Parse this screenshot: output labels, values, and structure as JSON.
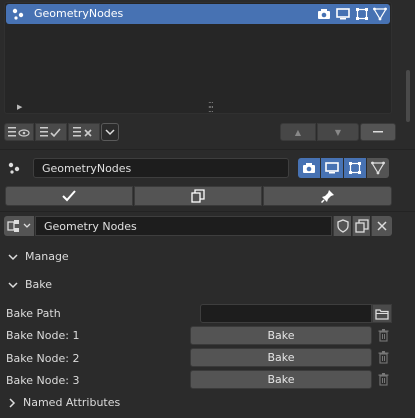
{
  "modifier_list": {
    "items": [
      {
        "label": "GeometryNodes",
        "selected": true
      }
    ]
  },
  "list_toolbar": {
    "icons": [
      "eye-list-icon",
      "checklist-icon",
      "x-list-icon",
      "chevron-down-icon",
      "triangle-up-icon",
      "triangle-down-icon",
      "minus-icon"
    ]
  },
  "modifier": {
    "name": "GeometryNodes",
    "actions": [
      "apply-check-icon",
      "duplicate-icon",
      "pin-icon"
    ]
  },
  "node_group": {
    "name": "Geometry Nodes"
  },
  "panels": {
    "manage": "Manage",
    "bake": "Bake",
    "named_attributes": "Named Attributes"
  },
  "bake": {
    "path_label": "Bake Path",
    "path_value": "",
    "nodes": [
      {
        "label": "Bake Node: 1",
        "button": "Bake"
      },
      {
        "label": "Bake Node: 2",
        "button": "Bake"
      },
      {
        "label": "Bake Node: 3",
        "button": "Bake"
      }
    ]
  },
  "colors": {
    "accent": "#4772b3",
    "background": "#2b2b2b",
    "field": "#1d1d1d",
    "button": "#545454"
  }
}
